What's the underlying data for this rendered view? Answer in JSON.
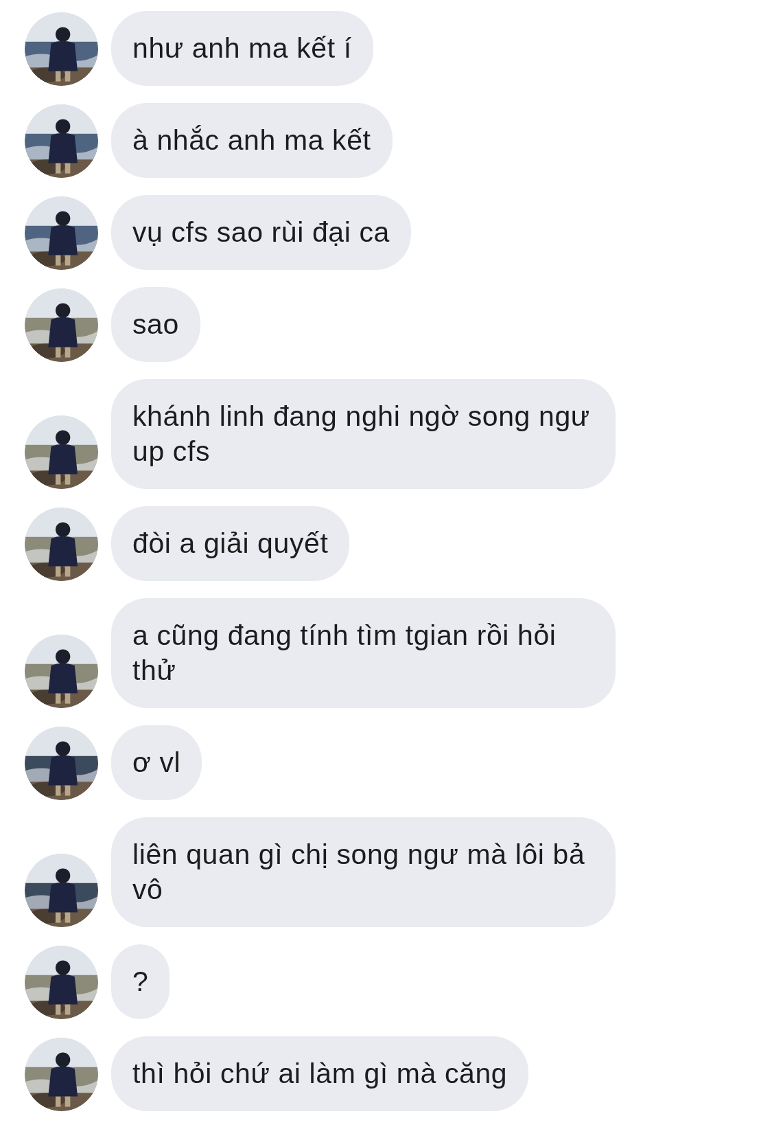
{
  "messages": [
    {
      "text": "như anh ma kết í"
    },
    {
      "text": "à nhắc anh ma kết"
    },
    {
      "text": "vụ cfs sao rùi đại ca"
    },
    {
      "text": "sao"
    },
    {
      "text": "khánh linh đang nghi ngờ song ngư up cfs"
    },
    {
      "text": "đòi a giải quyết"
    },
    {
      "text": "a cũng đang tính tìm tgian rồi hỏi thử"
    },
    {
      "text": "ơ vl"
    },
    {
      "text": "liên quan gì chị song ngư mà lôi bả vô"
    },
    {
      "text": "?"
    },
    {
      "text": "thì hỏi chứ ai làm gì mà căng"
    }
  ]
}
